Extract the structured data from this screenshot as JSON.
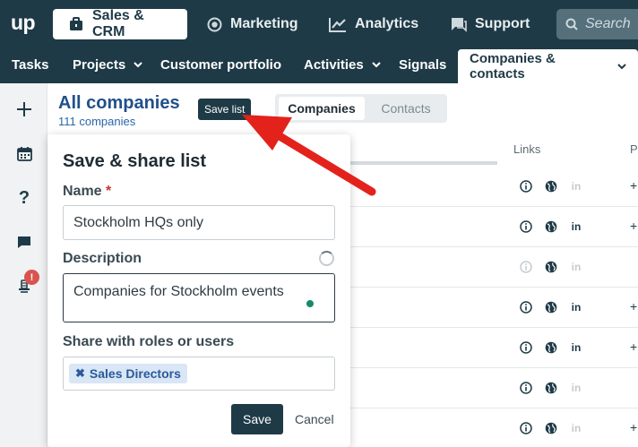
{
  "app": {
    "logo": "up"
  },
  "topnav": [
    {
      "label": "Sales & CRM",
      "icon": "briefcase-icon",
      "active": true
    },
    {
      "label": "Marketing",
      "icon": "target-icon",
      "active": false
    },
    {
      "label": "Analytics",
      "icon": "chart-icon",
      "active": false
    },
    {
      "label": "Support",
      "icon": "chat-icon",
      "active": false
    }
  ],
  "search": {
    "placeholder": "Search"
  },
  "subnav": [
    {
      "label": "Tasks",
      "chevron": false
    },
    {
      "label": "Projects",
      "chevron": true
    },
    {
      "label": "Customer portfolio",
      "chevron": false
    },
    {
      "label": "Activities",
      "chevron": true
    },
    {
      "label": "Signals",
      "chevron": false
    },
    {
      "label": "Companies & contacts",
      "chevron": true,
      "active": true
    }
  ],
  "rail": {
    "icons": [
      "plus-icon",
      "calendar-icon",
      "help-icon",
      "message-icon",
      "bell-icon"
    ],
    "badge": "!"
  },
  "header": {
    "title": "All companies",
    "count": "111 companies",
    "save_list": "Save list"
  },
  "tabs": {
    "active": "Companies",
    "inactive": "Contacts"
  },
  "table": {
    "links_header": "Links",
    "p_header": "P",
    "rows": [
      {
        "info": true,
        "web": true,
        "linkedin": false,
        "plus": true
      },
      {
        "info": true,
        "web": true,
        "linkedin": true,
        "plus": true
      },
      {
        "info": false,
        "web": true,
        "linkedin": false,
        "plus": false
      },
      {
        "info": true,
        "web": true,
        "linkedin": true,
        "plus": true
      },
      {
        "info": true,
        "web": true,
        "linkedin": true,
        "plus": true
      },
      {
        "info": true,
        "web": true,
        "linkedin": false,
        "plus": false
      },
      {
        "info": true,
        "web": true,
        "linkedin": false,
        "plus": true
      }
    ]
  },
  "popover": {
    "title": "Save & share list",
    "name_label": "Name",
    "required_mark": "*",
    "name_value": "Stockholm HQs only",
    "description_label": "Description",
    "description_value": "Companies for Stockholm events",
    "share_label": "Share with roles or users",
    "chip": "Sales Directors",
    "save_button": "Save",
    "cancel_button": "Cancel"
  },
  "colors": {
    "nav_bg": "#1e3a46",
    "title_blue": "#21508a",
    "arrow_red": "#e3221c",
    "chip_bg": "#d9e6f5"
  }
}
